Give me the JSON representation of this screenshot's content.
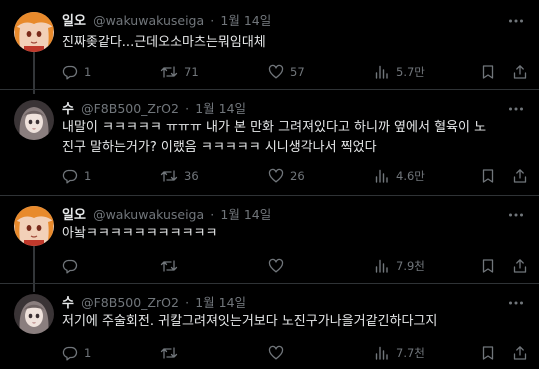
{
  "tweets": [
    {
      "name": "일오",
      "handle": "@wakuwakuseiga",
      "separator": "·",
      "date": "1월 14일",
      "text": "진짜좆같다...근데오소마츠는뭐임대체",
      "replies": "1",
      "retweets": "71",
      "likes": "57",
      "views": "5.7만",
      "avatar": "orange-hair-character"
    },
    {
      "name": "수",
      "handle": "@F8B500_ZrO2",
      "separator": "·",
      "date": "1월 14일",
      "text": "내말이 ㅋㅋㅋㅋㅋ ㅠㅠㅠ 내가 본 만화 그려져있다고 하니까 옆에서 혈육이 노\n진구 말하는거가? 이랬음 ㅋㅋㅋㅋㅋ 시니생각나서 찍었다",
      "replies": "1",
      "retweets": "36",
      "likes": "26",
      "views": "4.6만",
      "avatar": "pale-girl-character"
    },
    {
      "name": "일오",
      "handle": "@wakuwakuseiga",
      "separator": "·",
      "date": "1월 14일",
      "text": "아놬ㅋㅋㅋㅋㅋㅋㅋㅋㅋㅋㅋ",
      "replies": "",
      "retweets": "",
      "likes": "",
      "views": "7.9천",
      "avatar": "orange-hair-character"
    },
    {
      "name": "수",
      "handle": "@F8B500_ZrO2",
      "separator": "·",
      "date": "1월 14일",
      "text": "저기에 주술회전. 귀칼그려져잇는거보다 노진구가나을거같긴하다그지",
      "replies": "1",
      "retweets": "",
      "likes": "",
      "views": "7.7천",
      "avatar": "pale-girl-character"
    }
  ],
  "icons": {
    "reply": "reply-icon",
    "retweet": "retweet-icon",
    "like": "heart-icon",
    "views": "views-icon",
    "bookmark": "bookmark-icon",
    "share": "share-icon",
    "more": "more-options-icon"
  },
  "colors": {
    "background": "#000000",
    "text": "#e7e9ea",
    "muted": "#71767b",
    "divider": "#2f3336"
  }
}
